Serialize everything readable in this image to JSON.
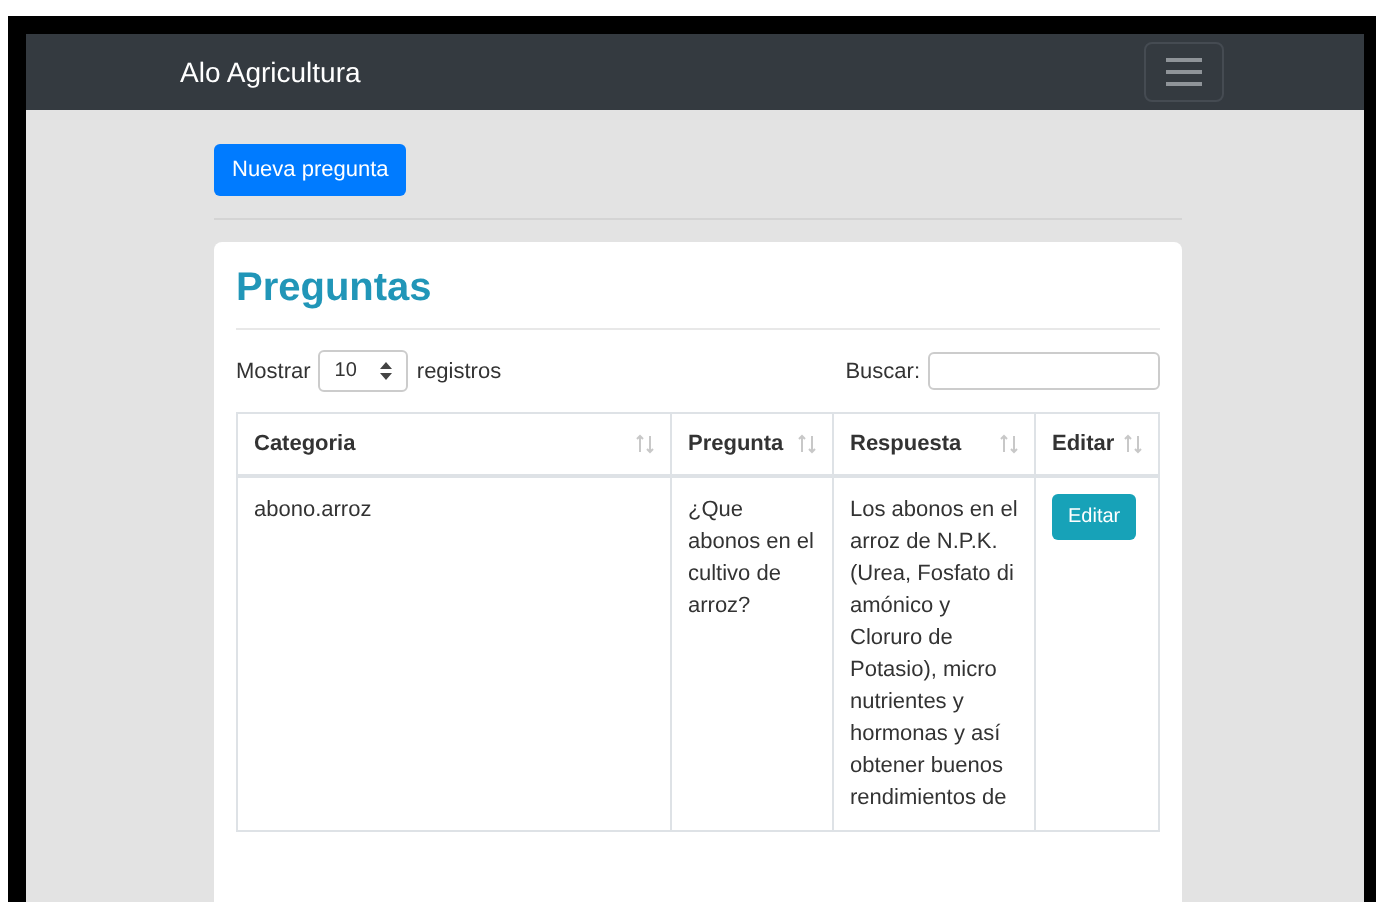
{
  "navbar": {
    "brand": "Alo Agricultura"
  },
  "toolbar": {
    "new_button": "Nueva pregunta"
  },
  "card": {
    "title": "Preguntas",
    "length_control": {
      "before": "Mostrar",
      "value": "10",
      "after": "registros"
    },
    "search": {
      "label": "Buscar:"
    },
    "table": {
      "columns": [
        "Categoria",
        "Pregunta",
        "Respuesta",
        "Editar"
      ],
      "rows": [
        {
          "categoria": "abono.arroz",
          "pregunta": "¿Que abonos en el cultivo de arroz?",
          "respuesta": "Los abonos en el arroz de N.P.K. (Urea, Fosfato di amónico y Cloruro de Potasio), micro nutrientes y hormonas y así obtener buenos rendimientos de",
          "action": "Editar"
        }
      ]
    }
  }
}
